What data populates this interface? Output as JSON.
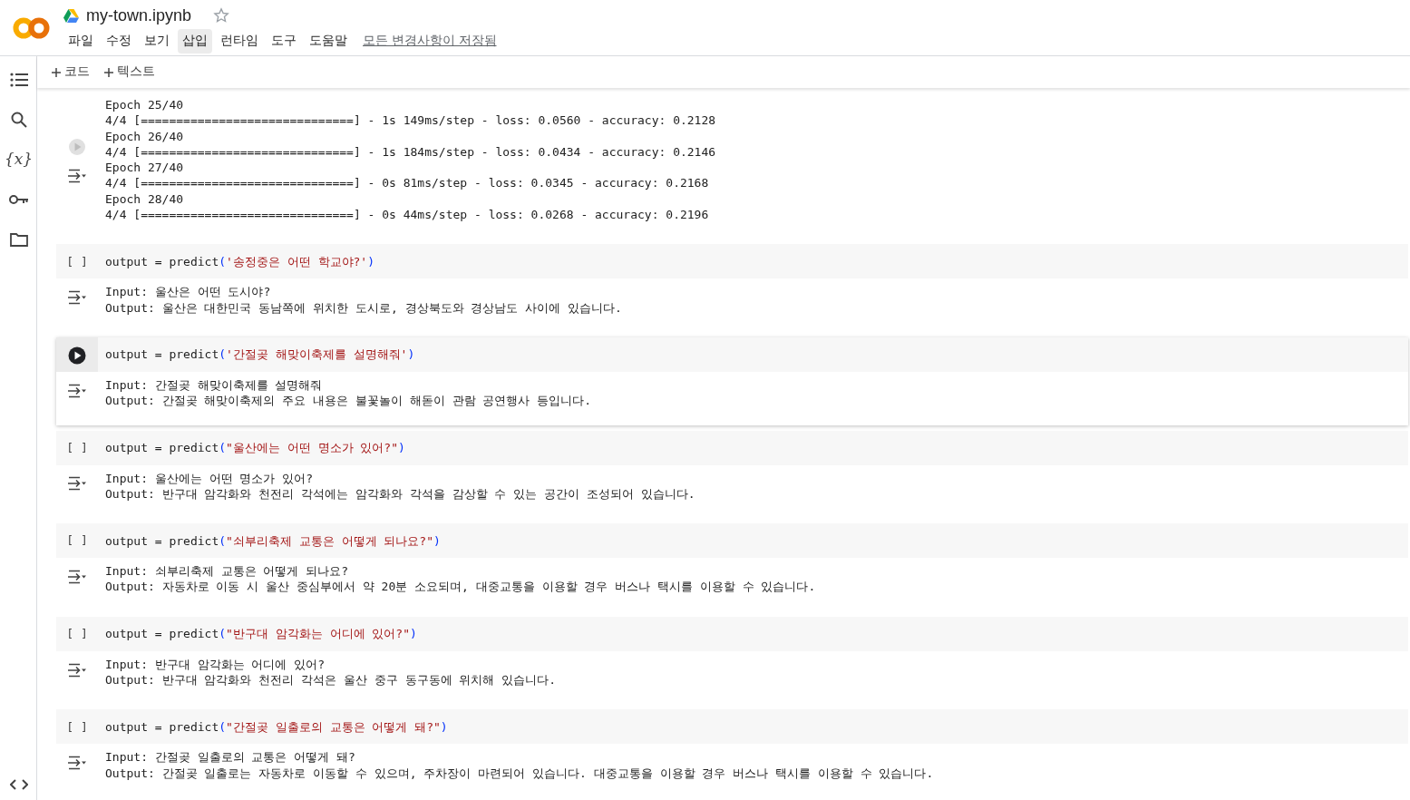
{
  "header": {
    "title": "my-town.ipynb",
    "starred": false,
    "menu": [
      {
        "label": "파일",
        "selected": false
      },
      {
        "label": "수정",
        "selected": false
      },
      {
        "label": "보기",
        "selected": false
      },
      {
        "label": "삽입",
        "selected": true
      },
      {
        "label": "런타임",
        "selected": false
      },
      {
        "label": "도구",
        "selected": false
      },
      {
        "label": "도움말",
        "selected": false
      }
    ],
    "save_status": "모든 변경사항이 저장됨"
  },
  "sidebar": [
    {
      "kind": "toc"
    },
    {
      "kind": "search"
    },
    {
      "kind": "variables",
      "glyph": "{x}"
    },
    {
      "kind": "secrets"
    },
    {
      "kind": "files"
    }
  ],
  "toolbar": [
    {
      "label": "코드"
    },
    {
      "label": "텍스트"
    }
  ],
  "training_output": {
    "lines": [
      "Epoch 25/40",
      "4/4 [==============================] - 1s 149ms/step - loss: 0.0560 - accuracy: 0.2128",
      "Epoch 26/40",
      "4/4 [==============================] - 1s 184ms/step - loss: 0.0434 - accuracy: 0.2146",
      "Epoch 27/40",
      "4/4 [==============================] - 0s 81ms/step - loss: 0.0345 - accuracy: 0.2168",
      "Epoch 28/40",
      "4/4 [==============================] - 0s 44ms/step - loss: 0.0268 - accuracy: 0.2196"
    ]
  },
  "cells": [
    {
      "selected": false,
      "gutter": "[ ]",
      "code": [
        {
          "kind": "plain",
          "text": "output = predict"
        },
        {
          "kind": "paren",
          "text": "("
        },
        {
          "kind": "string",
          "text": "'송정중은 어떤 학교야?'"
        },
        {
          "kind": "paren",
          "text": ")"
        }
      ],
      "output": [
        "Input: 울산은 어떤 도시야?",
        "Output: 울산은 대한민국 동남쪽에 위치한 도시로, 경상북도와 경상남도 사이에 있습니다."
      ]
    },
    {
      "selected": true,
      "code": [
        {
          "kind": "plain",
          "text": "output = predict"
        },
        {
          "kind": "paren",
          "text": "("
        },
        {
          "kind": "string",
          "text": "'간절곶 해맞이축제를 설명해줘'"
        },
        {
          "kind": "paren",
          "text": ")"
        }
      ],
      "output": [
        "Input: 간절곶 해맞이축제를 설명해줘",
        "Output: 간절곶 해맞이축제의 주요 내용은 불꽃놀이 해돋이 관람 공연행사 등입니다."
      ]
    },
    {
      "selected": false,
      "gutter": "[ ]",
      "code": [
        {
          "kind": "plain",
          "text": "output = predict"
        },
        {
          "kind": "paren",
          "text": "("
        },
        {
          "kind": "string",
          "text": "\"울산에는 어떤 명소가 있어?\""
        },
        {
          "kind": "paren",
          "text": ")"
        }
      ],
      "output": [
        "Input: 울산에는 어떤 명소가 있어?",
        "Output: 반구대 암각화와 천전리 각석에는 암각화와 각석을 감상할 수 있는 공간이 조성되어 있습니다."
      ]
    },
    {
      "selected": false,
      "gutter": "[ ]",
      "code": [
        {
          "kind": "plain",
          "text": "output = predict"
        },
        {
          "kind": "paren",
          "text": "("
        },
        {
          "kind": "string",
          "text": "\"쇠부리축제 교통은 어떻게 되나요?\""
        },
        {
          "kind": "paren",
          "text": ")"
        }
      ],
      "output": [
        "Input: 쇠부리축제 교통은 어떻게 되나요?",
        "Output: 자동차로 이동 시 울산 중심부에서 약 20분 소요되며, 대중교통을 이용할 경우 버스나 택시를 이용할 수 있습니다."
      ]
    },
    {
      "selected": false,
      "gutter": "[ ]",
      "code": [
        {
          "kind": "plain",
          "text": "output = predict"
        },
        {
          "kind": "paren",
          "text": "("
        },
        {
          "kind": "string",
          "text": "\"반구대 암각화는 어디에 있어?\""
        },
        {
          "kind": "paren",
          "text": ")"
        }
      ],
      "output": [
        "Input: 반구대 암각화는 어디에 있어?",
        "Output: 반구대 암각화와 천전리 각석은 울산 중구 동구동에 위치해 있습니다."
      ]
    },
    {
      "selected": false,
      "gutter": "[ ]",
      "code": [
        {
          "kind": "plain",
          "text": "output = predict"
        },
        {
          "kind": "paren",
          "text": "("
        },
        {
          "kind": "string",
          "text": "\"간절곶 일출로의 교통은 어떻게 돼?\""
        },
        {
          "kind": "paren",
          "text": ")"
        }
      ],
      "output": [
        "Input: 간절곶 일출로의 교통은 어떻게 돼?",
        "Output: 간절곶 일출로는 자동차로 이동할 수 있으며, 주차장이 마련되어 있습니다. 대중교통을 이용할 경우 버스나 택시를 이용할 수 있습니다."
      ]
    }
  ]
}
